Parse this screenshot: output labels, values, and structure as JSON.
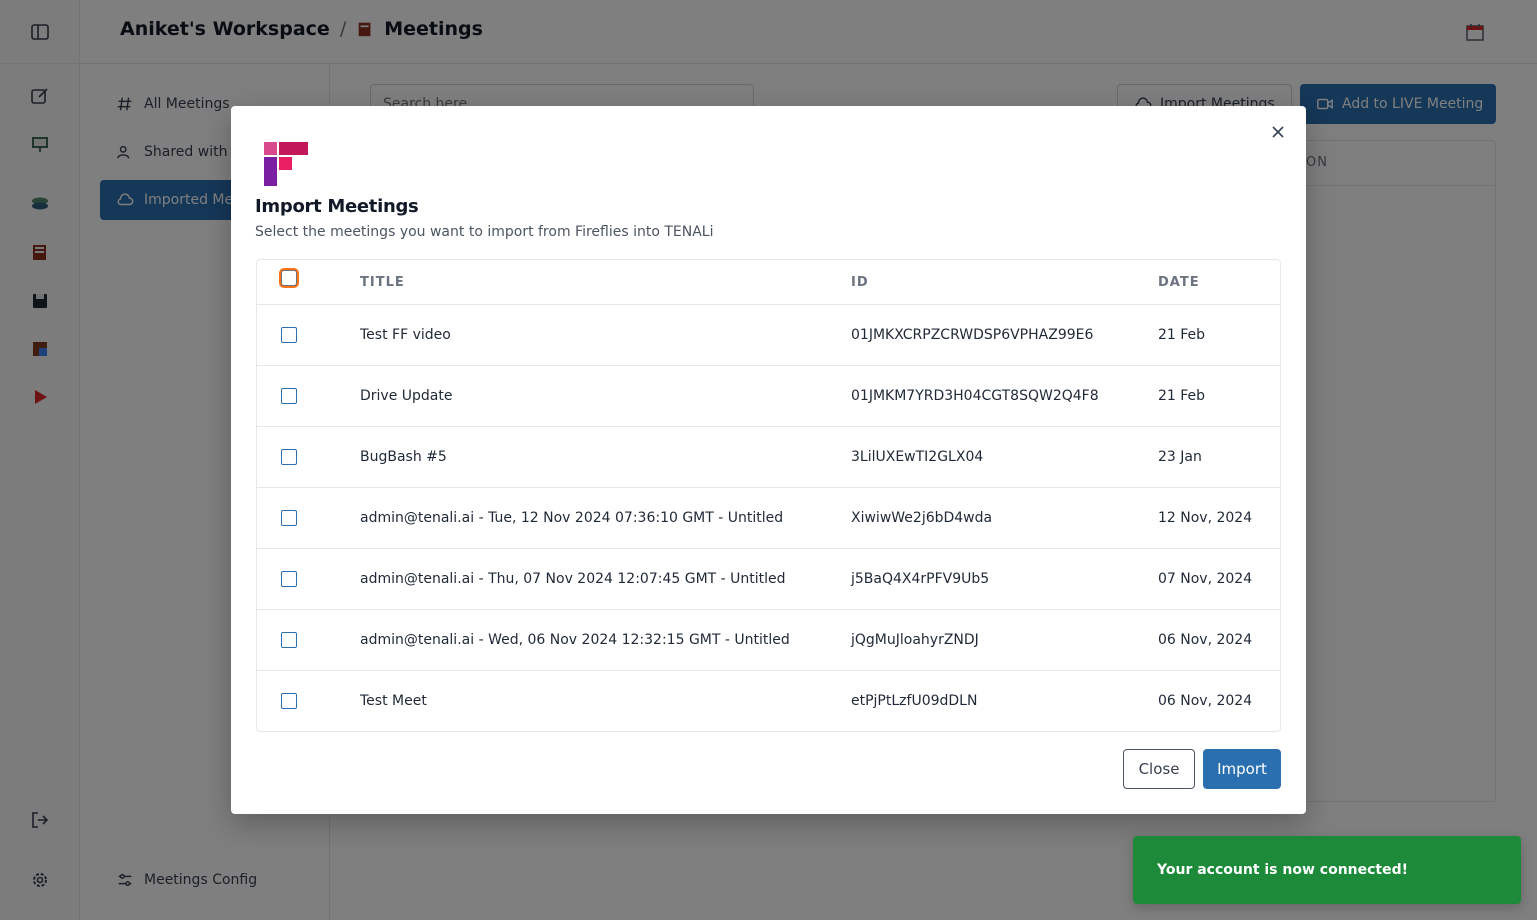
{
  "breadcrumb": {
    "workspace": "Aniket's Workspace",
    "separator": "/",
    "page": "Meetings"
  },
  "rail_icons": [
    "sidebar-toggle-icon",
    "edit-icon",
    "presentation-icon",
    "stack-icon",
    "meeting-notes-icon",
    "floppy-disk-icon",
    "tape-icon",
    "play-icon",
    "logout-icon",
    "gear-icon"
  ],
  "subnav": {
    "items": [
      {
        "label": "All Meetings",
        "icon": "hash-icon"
      },
      {
        "label": "Shared with Me",
        "icon": "users-icon"
      },
      {
        "label": "Imported Meetings",
        "icon": "cloud-icon"
      }
    ],
    "config_label": "Meetings Config"
  },
  "main": {
    "search_placeholder": "Search here",
    "import_button": "Import Meetings",
    "add_live_button": "Add to LIVE Meeting",
    "column_partial": "ON"
  },
  "modal": {
    "title": "Import Meetings",
    "subtitle": "Select the meetings you want to import from Fireflies into TENALi",
    "columns": {
      "title": "TITLE",
      "id": "ID",
      "date": "DATE"
    },
    "rows": [
      {
        "title": "Test FF video",
        "id": "01JMKXCRPZCRWDSP6VPHAZ99E6",
        "date": "21 Feb"
      },
      {
        "title": "Drive Update",
        "id": "01JMKM7YRD3H04CGT8SQW2Q4F8",
        "date": "21 Feb"
      },
      {
        "title": "BugBash #5",
        "id": "3LilUXEwTI2GLX04",
        "date": "23 Jan"
      },
      {
        "title": "admin@tenali.ai - Tue, 12 Nov 2024 07:36:10 GMT - Untitled",
        "id": "XiwiwWe2j6bD4wda",
        "date": "12 Nov, 2024"
      },
      {
        "title": "admin@tenali.ai - Thu, 07 Nov 2024 12:07:45 GMT - Untitled",
        "id": "j5BaQ4X4rPFV9Ub5",
        "date": "07 Nov, 2024"
      },
      {
        "title": "admin@tenali.ai - Wed, 06 Nov 2024 12:32:15 GMT - Untitled",
        "id": "jQgMuJloahyrZNDJ",
        "date": "06 Nov, 2024"
      },
      {
        "title": "Test Meet",
        "id": "etPjPtLzfU09dDLN",
        "date": "06 Nov, 2024"
      }
    ],
    "close_label": "Close",
    "import_label": "Import"
  },
  "toast": {
    "message": "Your account is now connected!"
  },
  "colors": {
    "primary": "#2a6fb0",
    "success": "#1d8a3a",
    "focus_ring": "#f97316",
    "fireflies_brand": "#c2185b"
  }
}
